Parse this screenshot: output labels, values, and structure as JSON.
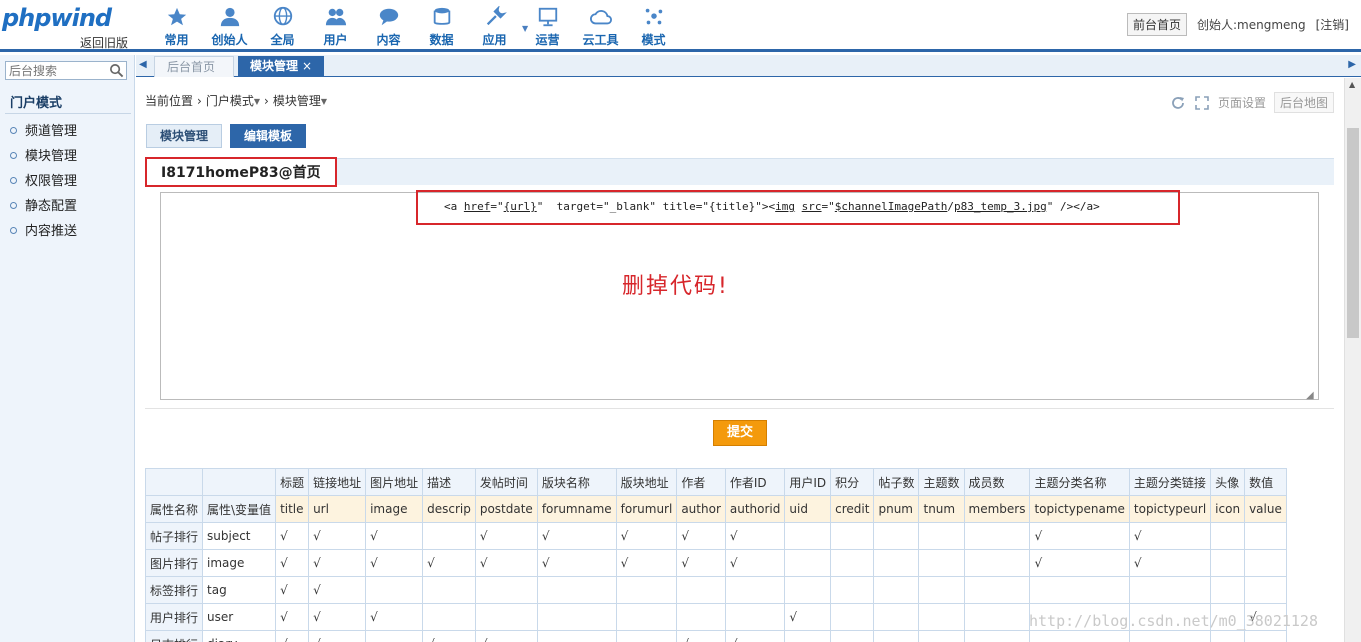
{
  "header": {
    "logo": "phpwind",
    "logo_sub": "返回旧版",
    "nav": [
      {
        "label": "常用",
        "icon": "star-icon"
      },
      {
        "label": "创始人",
        "icon": "user-icon"
      },
      {
        "label": "全局",
        "icon": "globe-icon"
      },
      {
        "label": "用户",
        "icon": "users-icon"
      },
      {
        "label": "内容",
        "icon": "chat-icon"
      },
      {
        "label": "数据",
        "icon": "database-icon"
      },
      {
        "label": "应用",
        "icon": "wrench-icon"
      },
      {
        "label": "运营",
        "icon": "monitor-icon"
      },
      {
        "label": "云工具",
        "icon": "cloud-icon"
      },
      {
        "label": "模式",
        "icon": "sparkle-icon"
      }
    ],
    "front_home": "前台首页",
    "creator": "创始人:mengmeng",
    "logout": "[注销]"
  },
  "sidebar": {
    "search_placeholder": "后台搜索",
    "title": "门户模式",
    "items": [
      "频道管理",
      "模块管理",
      "权限管理",
      "静态配置",
      "内容推送"
    ]
  },
  "tabs": {
    "home": "后台首页",
    "module": "模块管理",
    "close": "×"
  },
  "breadcrumb": {
    "root": "当前位置",
    "level1": "门户模式",
    "level2": "模块管理"
  },
  "tools": {
    "page_settings": "页面设置",
    "site_map": "后台地图"
  },
  "subtabs": {
    "module_manage": "模块管理",
    "edit_template": "编辑模板"
  },
  "block_title": "I8171homeP83@首页",
  "code": {
    "p1": "<a ",
    "p2": "href",
    "p3": "=\"",
    "p4": "{url}",
    "p5": "\"  target=\"_blank\" title=\"{title}\"><",
    "p6": "img",
    "p7": " ",
    "p8": "src",
    "p9": "=\"",
    "p10": "$channelImagePath",
    "p11": "/",
    "p12": "p83_temp_3.jpg",
    "p13": "\" /></a>"
  },
  "delete_note": "删掉代码!",
  "submit": "提交",
  "table": {
    "headers": [
      "标题",
      "链接地址",
      "图片地址",
      "描述",
      "发帖时间",
      "版块名称",
      "版块地址",
      "作者",
      "作者ID",
      "用户ID",
      "积分",
      "帖子数",
      "主题数",
      "成员数",
      "主题分类名称",
      "主题分类链接",
      "头像",
      "数值"
    ],
    "attr_label": "属性名称",
    "var_label": "属性\\变量值",
    "vars": [
      "title",
      "url",
      "image",
      "descrip",
      "postdate",
      "forumname",
      "forumurl",
      "author",
      "authorid",
      "uid",
      "credit",
      "pnum",
      "tnum",
      "members",
      "topictypename",
      "topictypeurl",
      "icon",
      "value"
    ],
    "rows": [
      {
        "name": "帖子排行",
        "key": "subject",
        "cells": [
          "√",
          "√",
          "√",
          "",
          "√",
          "√",
          "√",
          "√",
          "√",
          "",
          "",
          "",
          "",
          "",
          "√",
          "√",
          "",
          ""
        ]
      },
      {
        "name": "图片排行",
        "key": "image",
        "cells": [
          "√",
          "√",
          "√",
          "√",
          "√",
          "√",
          "√",
          "√",
          "√",
          "",
          "",
          "",
          "",
          "",
          "√",
          "√",
          "",
          ""
        ]
      },
      {
        "name": "标签排行",
        "key": "tag",
        "cells": [
          "√",
          "√",
          "",
          "",
          "",
          "",
          "",
          "",
          "",
          "",
          "",
          "",
          "",
          "",
          "",
          "",
          "",
          ""
        ]
      },
      {
        "name": "用户排行",
        "key": "user",
        "cells": [
          "√",
          "√",
          "√",
          "",
          "",
          "",
          "",
          "",
          "",
          "√",
          "",
          "",
          "",
          "",
          "",
          "",
          "",
          "√"
        ]
      },
      {
        "name": "日志排行",
        "key": "diary",
        "cells": [
          "√",
          "√",
          "",
          "√",
          "√",
          "",
          "",
          "√",
          "√",
          "",
          "",
          "",
          "",
          "",
          "",
          "",
          "",
          ""
        ]
      }
    ]
  },
  "watermark": "http://blog.csdn.net/m0_38021128"
}
